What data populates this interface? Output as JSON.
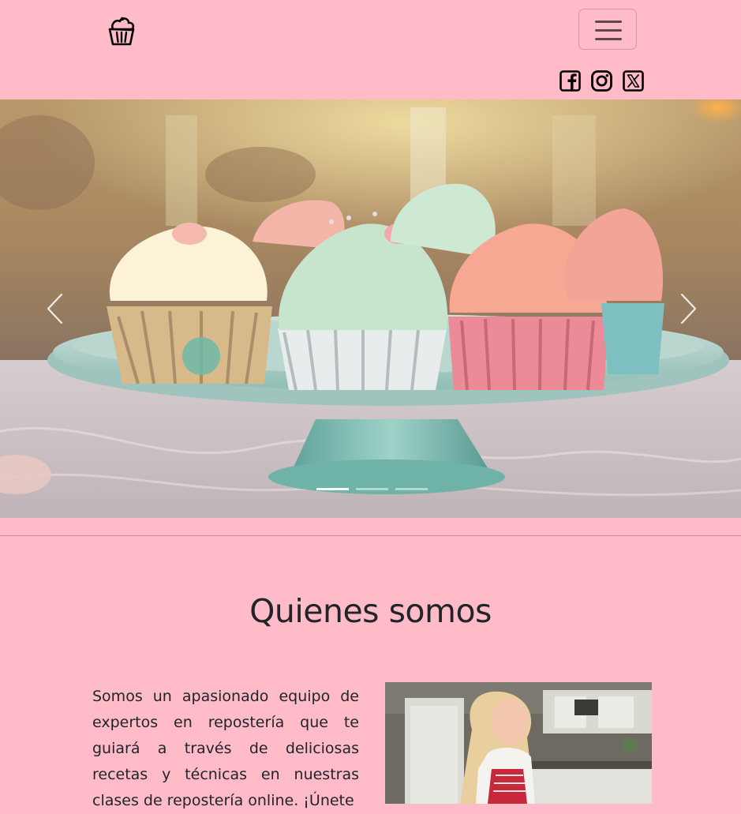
{
  "navbar": {
    "brand_icon": "cupcake-icon",
    "toggle_icon": "hamburger-menu-icon",
    "social": [
      {
        "icon": "facebook-icon"
      },
      {
        "icon": "instagram-icon"
      },
      {
        "icon": "x-twitter-icon"
      }
    ]
  },
  "carousel": {
    "slide_count": 3,
    "active_index": 0,
    "prev_icon": "chevron-left-icon",
    "next_icon": "chevron-right-icon"
  },
  "about": {
    "title": "Quienes somos",
    "text": "Somos un apasionado equipo de expertos en repostería que te guiará a través de deliciosas recetas y técnicas en nuestras clases de repostería online. ¡Únete"
  },
  "colors": {
    "background": "#ffbbc8",
    "text": "#212529"
  }
}
